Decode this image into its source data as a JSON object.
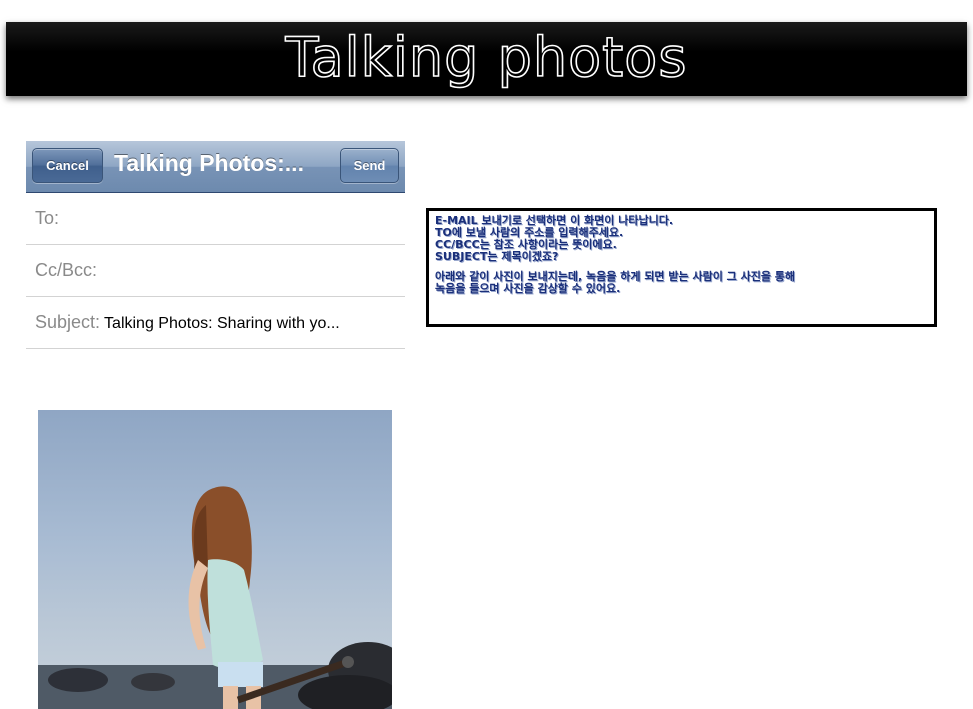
{
  "banner": {
    "title": "Talking photos"
  },
  "mail": {
    "cancel_label": "Cancel",
    "title": "Talking Photos:...",
    "send_label": "Send",
    "to_label": "To:",
    "cc_label": "Cc/Bcc:",
    "subject_label": "Subject:",
    "subject_value": "Talking Photos: Sharing with yo..."
  },
  "description": {
    "lines": [
      "E-MAIL 보내기로 선택하면 이 화면이 나타납니다.",
      "TO에 보낼 사람의 주소를 입력해주세요.",
      "CC/BCC는 참조 사항이라는 뜻이에요.",
      "SUBJECT는 제목이겠죠?",
      "아래와 같이 사진이 보내지는데, 녹음을 하게 되면 받는 사람이 그 사진을 통해",
      "녹음을 들으며 사진을 감상할 수 있어요."
    ]
  },
  "colors": {
    "navbar": "#7893b6",
    "desc_text": "#1a2f7a",
    "banner": "#000000"
  }
}
